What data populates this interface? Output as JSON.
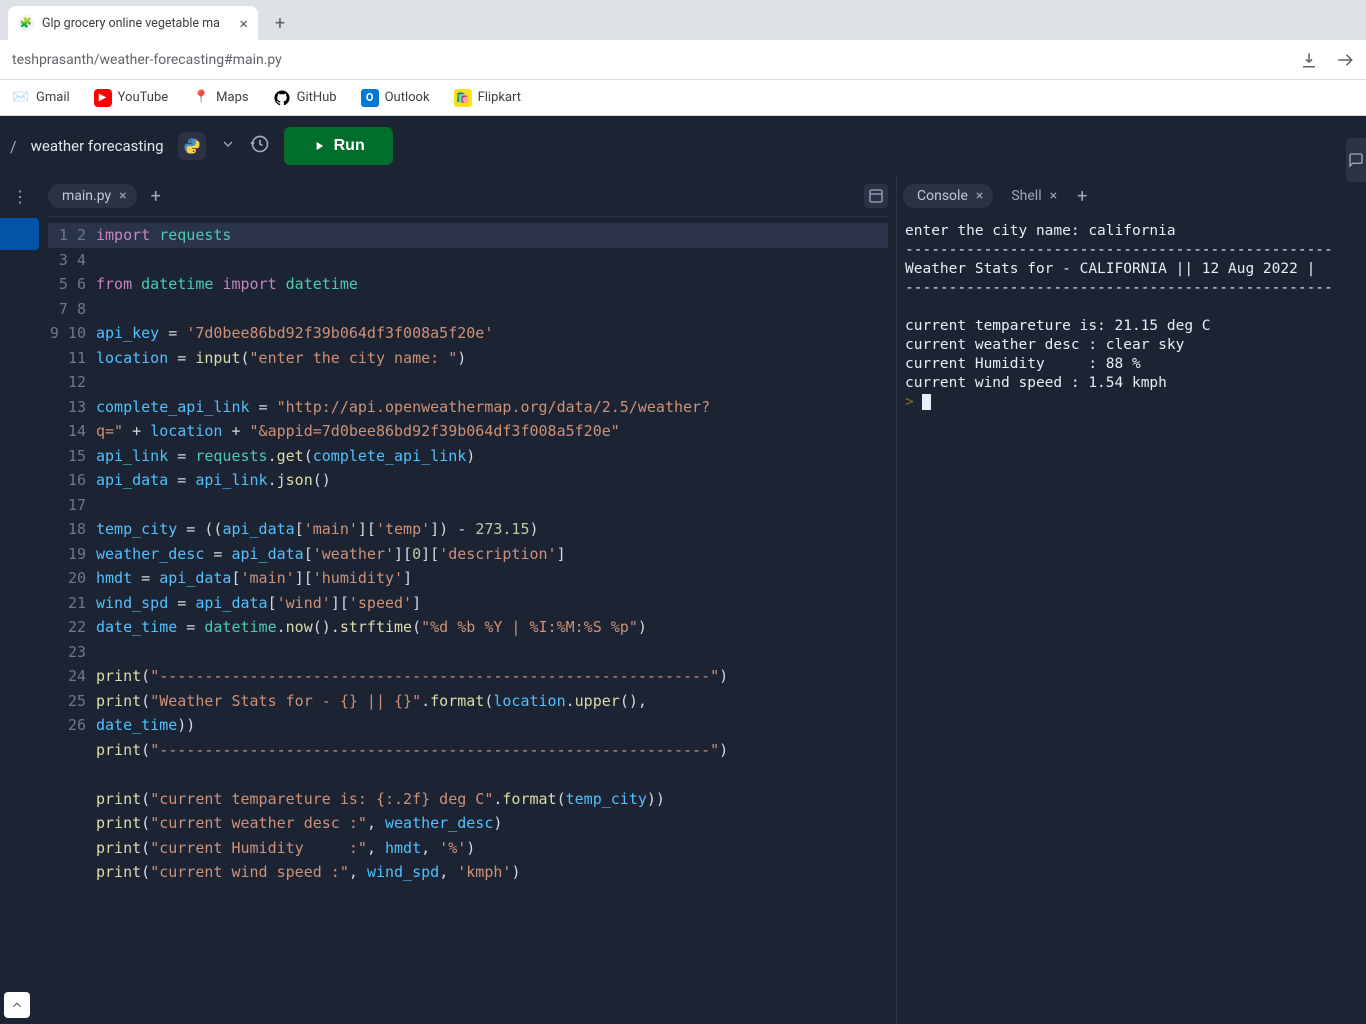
{
  "browser": {
    "tab_title": "Glp grocery online vegetable ma",
    "url": "teshprasanth/weather-forecasting#main.py",
    "bookmarks": [
      "Gmail",
      "YouTube",
      "Maps",
      "GitHub",
      "Outlook",
      "Flipkart"
    ]
  },
  "ide": {
    "project": "weather forecasting",
    "run_label": "Run",
    "file_tab": "main.py",
    "console_tab": "Console",
    "shell_tab": "Shell"
  },
  "code_lines": [
    {
      "n": 1,
      "html": "<span class='k-purple'>import</span> <span class='k-teal'>requests</span>"
    },
    {
      "n": 2,
      "html": ""
    },
    {
      "n": 3,
      "html": "<span class='k-purple'>from</span> <span class='k-teal'>datetime</span> <span class='k-purple'>import</span> <span class='k-teal'>datetime</span>"
    },
    {
      "n": 4,
      "html": ""
    },
    {
      "n": 5,
      "html": "<span class='k-blue'>api_key</span> = <span class='k-orange'>'7d0bee86bd92f39b064df3f008a5f20e'</span>"
    },
    {
      "n": 6,
      "html": "<span class='k-blue'>location</span> = <span class='k-yellow'>input</span>(<span class='k-orange'>\"enter the city name: \"</span>)"
    },
    {
      "n": 7,
      "html": ""
    },
    {
      "n": 8,
      "html": "<span class='k-blue'>complete_api_link</span> = <span class='k-orange'>\"http://api.openweathermap.org/data/2.5/weather?\nq=\"</span> + <span class='k-blue'>location</span> + <span class='k-orange'>\"&appid=7d0bee86bd92f39b064df3f008a5f20e\"</span>"
    },
    {
      "n": 9,
      "html": "<span class='k-blue'>api_link</span> = <span class='k-teal'>requests</span>.<span class='k-yellow'>get</span>(<span class='k-blue'>complete_api_link</span>)"
    },
    {
      "n": 10,
      "html": "<span class='k-blue'>api_data</span> = <span class='k-blue'>api_link</span>.<span class='k-yellow'>json</span>()"
    },
    {
      "n": 11,
      "html": ""
    },
    {
      "n": 12,
      "html": "<span class='k-blue'>temp_city</span> = ((<span class='k-blue'>api_data</span>[<span class='k-orange'>'main'</span>][<span class='k-orange'>'temp'</span>]) - <span class='k-num'>273.15</span>)"
    },
    {
      "n": 13,
      "html": "<span class='k-blue'>weather_desc</span> = <span class='k-blue'>api_data</span>[<span class='k-orange'>'weather'</span>][<span class='k-num'>0</span>][<span class='k-orange'>'description'</span>]"
    },
    {
      "n": 14,
      "html": "<span class='k-blue'>hmdt</span> = <span class='k-blue'>api_data</span>[<span class='k-orange'>'main'</span>][<span class='k-orange'>'humidity'</span>]"
    },
    {
      "n": 15,
      "html": "<span class='k-blue'>wind_spd</span> = <span class='k-blue'>api_data</span>[<span class='k-orange'>'wind'</span>][<span class='k-orange'>'speed'</span>]"
    },
    {
      "n": 16,
      "html": "<span class='k-blue'>date_time</span> = <span class='k-teal'>datetime</span>.<span class='k-yellow'>now</span>().<span class='k-yellow'>strftime</span>(<span class='k-orange'>\"%d %b %Y | %I:%M:%S %p\"</span>)"
    },
    {
      "n": 17,
      "html": ""
    },
    {
      "n": 18,
      "html": "<span class='k-yellow'>print</span>(<span class='k-orange'>\"-------------------------------------------------------------\"</span>)"
    },
    {
      "n": 19,
      "html": "<span class='k-yellow'>print</span>(<span class='k-orange'>\"Weather Stats for - {} || {}\"</span>.<span class='k-yellow'>format</span>(<span class='k-blue'>location</span>.<span class='k-yellow'>upper</span>(), \n<span class='k-blue'>date_time</span>))"
    },
    {
      "n": 20,
      "html": "<span class='k-yellow'>print</span>(<span class='k-orange'>\"-------------------------------------------------------------\"</span>)"
    },
    {
      "n": 21,
      "html": ""
    },
    {
      "n": 22,
      "html": "<span class='k-yellow'>print</span>(<span class='k-orange'>\"current tempareture is: {:.2f} deg C\"</span>.<span class='k-yellow'>format</span>(<span class='k-blue'>temp_city</span>))"
    },
    {
      "n": 23,
      "html": "<span class='k-yellow'>print</span>(<span class='k-orange'>\"current weather desc :\"</span>, <span class='k-blue'>weather_desc</span>)"
    },
    {
      "n": 24,
      "html": "<span class='k-yellow'>print</span>(<span class='k-orange'>\"current Humidity     :\"</span>, <span class='k-blue'>hmdt</span>, <span class='k-orange'>'%'</span>)"
    },
    {
      "n": 25,
      "html": "<span class='k-yellow'>print</span>(<span class='k-orange'>\"current wind speed :\"</span>, <span class='k-blue'>wind_spd</span>, <span class='k-orange'>'kmph'</span>)"
    },
    {
      "n": 26,
      "html": ""
    }
  ],
  "console_output": "enter the city name: california\n-------------------------------------------------\nWeather Stats for - CALIFORNIA || 12 Aug 2022 |\n-------------------------------------------------\n\ncurrent tempareture is: 21.15 deg C\ncurrent weather desc : clear sky\ncurrent Humidity     : 88 %\ncurrent wind speed : 1.54 kmph"
}
